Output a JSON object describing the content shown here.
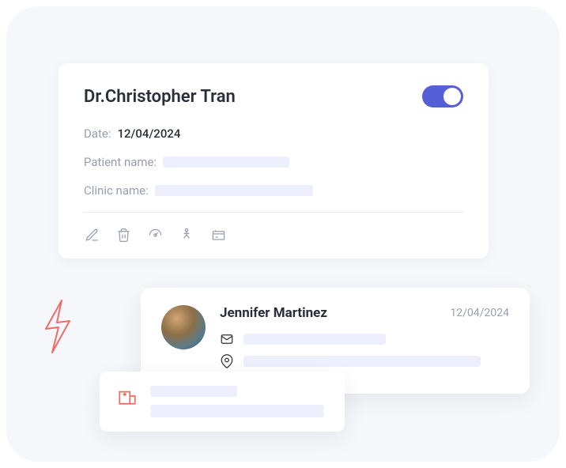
{
  "doctor": {
    "name": "Dr.Christopher Tran",
    "toggle_on": true,
    "date_label": "Date:",
    "date_value": "12/04/2024",
    "patient_label": "Patient name:",
    "clinic_label": "Clinic name:"
  },
  "patient": {
    "name": "Jennifer Martinez",
    "date": "12/04/2024"
  }
}
